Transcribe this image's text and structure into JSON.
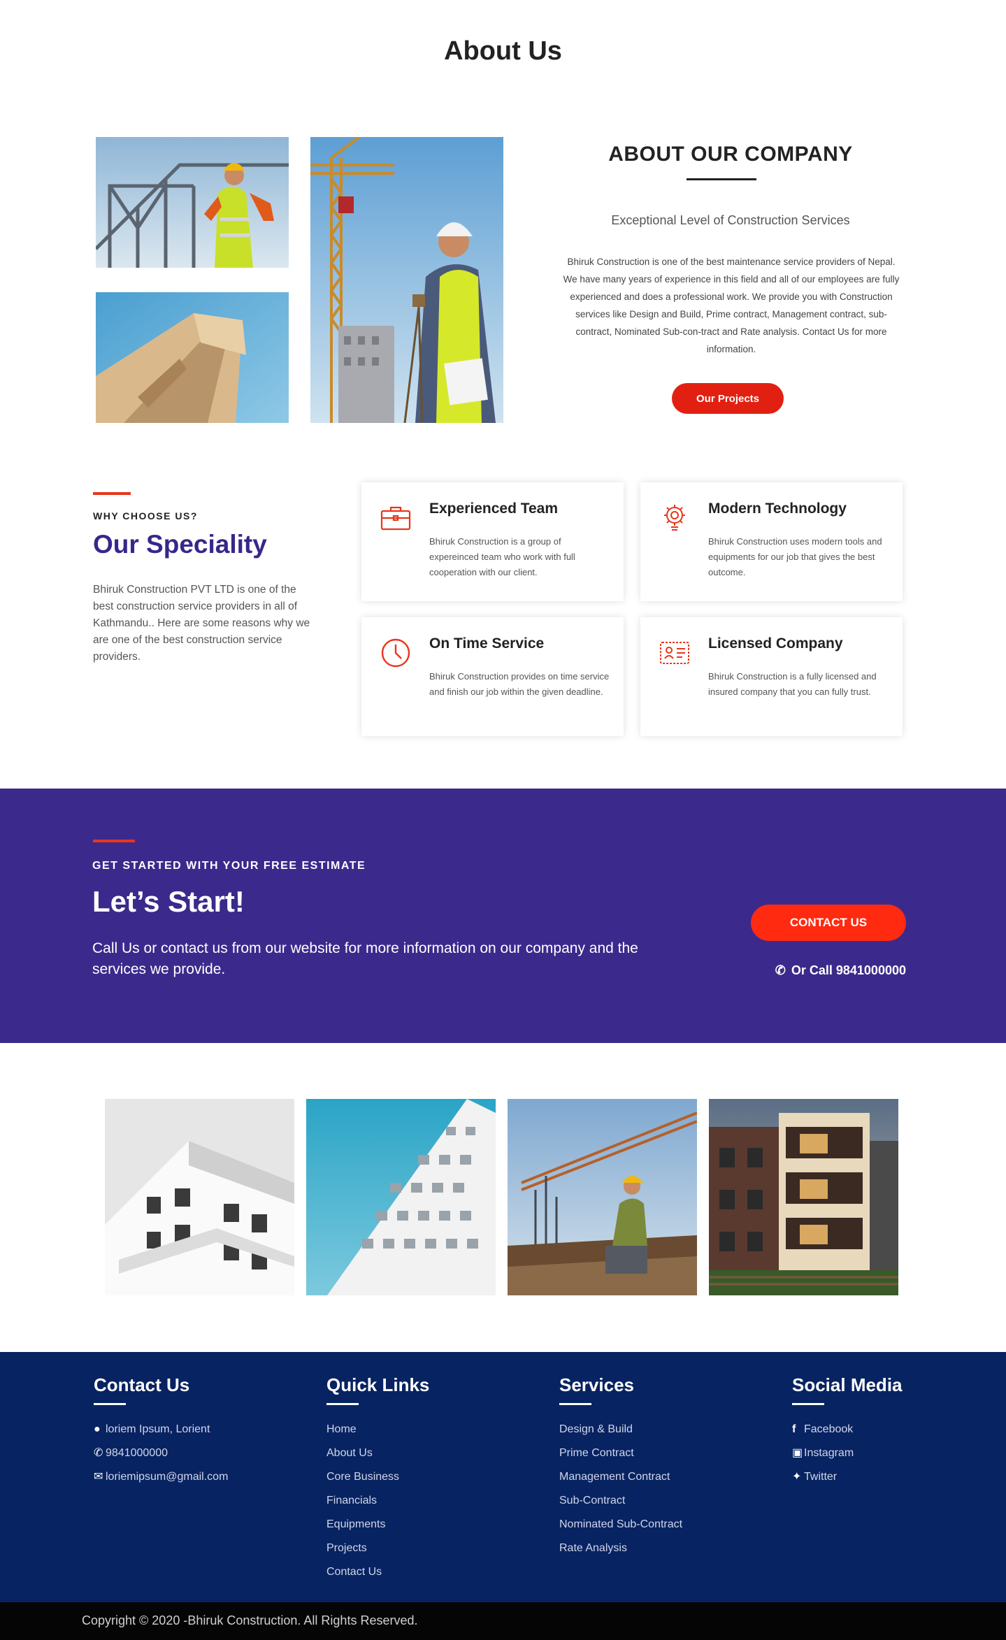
{
  "hero": {
    "title": "About Us"
  },
  "about": {
    "heading": "ABOUT OUR COMPANY",
    "subtitle": "Exceptional Level of Construction Services",
    "paragraph": "Bhiruk Construction is one of the best maintenance service providers of Nepal. We have many years of experience in this field and all of our employees are fully experienced and does a professional work. We provide you with Construction services like Design and Build, Prime contract, Management contract, sub-contract, Nominated Sub-con-tract and Rate analysis. Contact Us for more information.",
    "button_label": "Our Projects"
  },
  "why": {
    "eyebrow": "WHY CHOOSE US?",
    "heading": "Our Speciality",
    "paragraph": "Bhiruk Construction PVT LTD is one of the best construction service providers in all of Kathmandu.. Here are some reasons why we are one of the best construction service providers.",
    "cards": [
      {
        "title": "Experienced Team",
        "desc": "Bhiruk Construction is a group of expereinced team who work with full cooperation with our client.",
        "icon": "briefcase-icon"
      },
      {
        "title": "Modern Technology",
        "desc": "Bhiruk Construction uses modern tools and equipments for our job that gives the best outcome.",
        "icon": "gear-bulb-icon"
      },
      {
        "title": "On Time Service",
        "desc": "Bhiruk Construction provides on time service and finish our job within the given deadline.",
        "icon": "clock-icon"
      },
      {
        "title": "Licensed Company",
        "desc": "Bhiruk Construction is a fully licensed and insured company that you can fully trust.",
        "icon": "license-icon"
      }
    ]
  },
  "cta": {
    "eyebrow": "GET STARTED WITH YOUR FREE ESTIMATE",
    "heading": "Let’s Start!",
    "paragraph": "Call Us or contact us from our website for more information on our company and the services we provide.",
    "button_label": "CONTACT US",
    "call_text": "Or Call 9841000000"
  },
  "footer": {
    "contact": {
      "title": "Contact Us",
      "address": "loriem Ipsum, Lorient",
      "phone": "9841000000",
      "email": "loriemipsum@gmail.com"
    },
    "quick_links": {
      "title": "Quick Links",
      "items": [
        "Home",
        "About Us",
        "Core Business",
        "Financials",
        "Equipments",
        "Projects",
        "Contact Us"
      ]
    },
    "services": {
      "title": "Services",
      "items": [
        "Design & Build",
        "Prime Contract",
        "Management Contract",
        "Sub-Contract",
        "Nominated Sub-Contract",
        "Rate Analysis"
      ]
    },
    "social": {
      "title": "Social Media",
      "items": [
        "Facebook",
        "Instagram",
        "Twitter"
      ]
    }
  },
  "copyright": "Copyright © 2020 -Bhiruk Construction. All Rights Reserved.",
  "colors": {
    "accent": "#e22012",
    "purple": "#3b2a8c",
    "footer": "#082361"
  }
}
